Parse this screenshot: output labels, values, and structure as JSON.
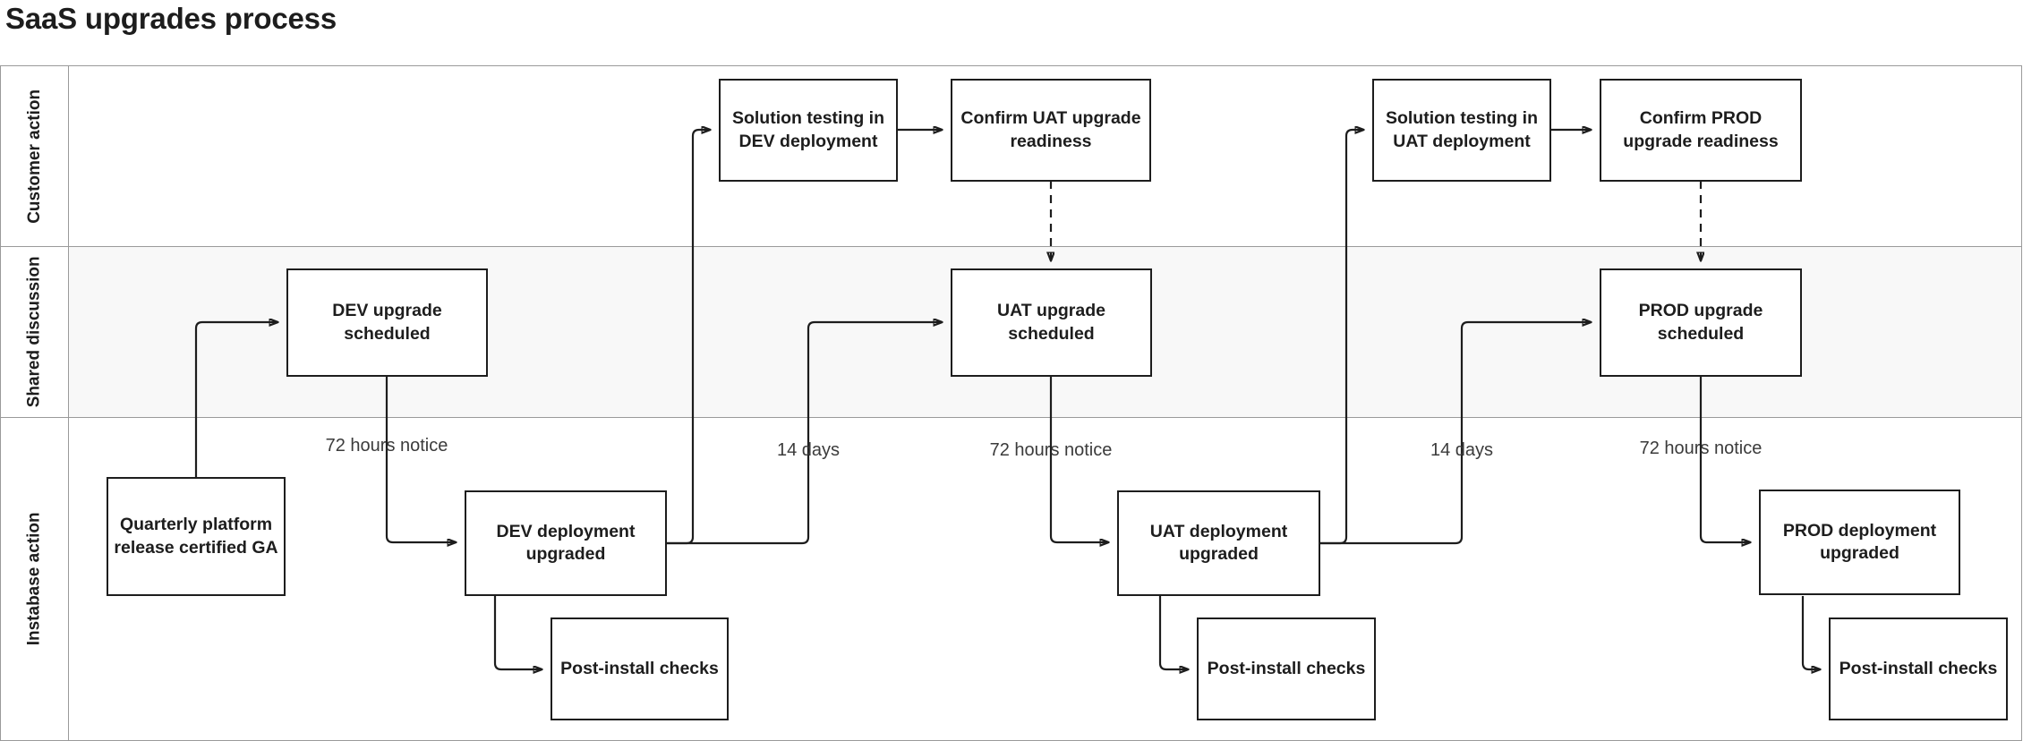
{
  "title": "SaaS upgrades process",
  "colors": {
    "ink": "#1d1d1d",
    "lane_border": "#9a9a9a",
    "lane_shaded_bg": "#f8f8f8",
    "edge_label": "#3b3b3b",
    "canvas": "#ffffff"
  },
  "lanes": [
    {
      "id": "customer-action",
      "label": "Customer\naction",
      "shaded": false
    },
    {
      "id": "shared-discussion",
      "label": "Shared\ndiscussion",
      "shaded": true
    },
    {
      "id": "instabase-action",
      "label": "Instabase action",
      "shaded": false
    }
  ],
  "nodes": [
    {
      "id": "solution-testing-dev",
      "lane": "customer-action",
      "label": "Solution testing in DEV deployment"
    },
    {
      "id": "confirm-uat-readiness",
      "lane": "customer-action",
      "label": "Confirm UAT upgrade readiness"
    },
    {
      "id": "solution-testing-uat",
      "lane": "customer-action",
      "label": "Solution testing in UAT deployment"
    },
    {
      "id": "confirm-prod-readiness",
      "lane": "customer-action",
      "label": "Confirm PROD upgrade readiness"
    },
    {
      "id": "dev-upgrade-scheduled",
      "lane": "shared-discussion",
      "label": "DEV upgrade scheduled"
    },
    {
      "id": "uat-upgrade-scheduled",
      "lane": "shared-discussion",
      "label": "UAT upgrade scheduled"
    },
    {
      "id": "prod-upgrade-scheduled",
      "lane": "shared-discussion",
      "label": "PROD upgrade scheduled"
    },
    {
      "id": "quarterly-release",
      "lane": "instabase-action",
      "label": "Quarterly platform release certified GA"
    },
    {
      "id": "dev-deployment-upgraded",
      "lane": "instabase-action",
      "label": "DEV deployment upgraded"
    },
    {
      "id": "post-install-checks-1",
      "lane": "instabase-action",
      "label": "Post-install checks"
    },
    {
      "id": "uat-deployment-upgraded",
      "lane": "instabase-action",
      "label": "UAT deployment upgraded"
    },
    {
      "id": "post-install-checks-2",
      "lane": "instabase-action",
      "label": "Post-install checks"
    },
    {
      "id": "prod-deployment-upgraded",
      "lane": "instabase-action",
      "label": "PROD deployment upgraded"
    },
    {
      "id": "post-install-checks-3",
      "lane": "instabase-action",
      "label": "Post-install checks"
    }
  ],
  "edge_labels": [
    {
      "id": "notice-dev",
      "text": "72 hours notice"
    },
    {
      "id": "days-dev",
      "text": "14 days"
    },
    {
      "id": "notice-uat",
      "text": "72 hours notice"
    },
    {
      "id": "days-uat",
      "text": "14 days"
    },
    {
      "id": "notice-prod",
      "text": "72 hours notice"
    }
  ],
  "edges": [
    {
      "from": "quarterly-release",
      "to": "dev-upgrade-scheduled",
      "style": "solid",
      "label": ""
    },
    {
      "from": "dev-upgrade-scheduled",
      "to": "dev-deployment-upgraded",
      "style": "solid",
      "label": "72 hours notice"
    },
    {
      "from": "dev-deployment-upgraded",
      "to": "post-install-checks-1",
      "style": "solid",
      "label": ""
    },
    {
      "from": "dev-deployment-upgraded",
      "to": "solution-testing-dev",
      "style": "solid",
      "label": ""
    },
    {
      "from": "dev-deployment-upgraded",
      "to": "uat-upgrade-scheduled",
      "style": "solid",
      "label": "14 days"
    },
    {
      "from": "solution-testing-dev",
      "to": "confirm-uat-readiness",
      "style": "solid",
      "label": ""
    },
    {
      "from": "confirm-uat-readiness",
      "to": "uat-upgrade-scheduled",
      "style": "dashed",
      "label": ""
    },
    {
      "from": "uat-upgrade-scheduled",
      "to": "uat-deployment-upgraded",
      "style": "solid",
      "label": "72 hours notice"
    },
    {
      "from": "uat-deployment-upgraded",
      "to": "post-install-checks-2",
      "style": "solid",
      "label": ""
    },
    {
      "from": "uat-deployment-upgraded",
      "to": "solution-testing-uat",
      "style": "solid",
      "label": ""
    },
    {
      "from": "uat-deployment-upgraded",
      "to": "prod-upgrade-scheduled",
      "style": "solid",
      "label": "14 days"
    },
    {
      "from": "solution-testing-uat",
      "to": "confirm-prod-readiness",
      "style": "solid",
      "label": ""
    },
    {
      "from": "confirm-prod-readiness",
      "to": "prod-upgrade-scheduled",
      "style": "dashed",
      "label": ""
    },
    {
      "from": "prod-upgrade-scheduled",
      "to": "prod-deployment-upgraded",
      "style": "solid",
      "label": "72 hours notice"
    },
    {
      "from": "prod-deployment-upgraded",
      "to": "post-install-checks-3",
      "style": "solid",
      "label": ""
    }
  ]
}
